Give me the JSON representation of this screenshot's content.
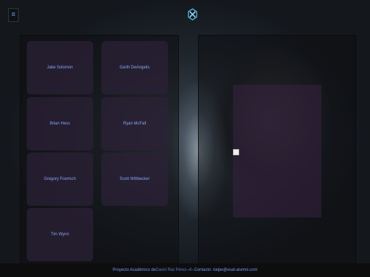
{
  "header": {
    "menu_icon": "hamburger-menu-icon",
    "logo_icon": "x-files-logo-icon"
  },
  "cast": [
    "Jake Solomon",
    "Garth DeAngelis",
    "Brian Hess",
    "Ryan McFall",
    "Gregory Foertsch",
    "Scott Wittbecker",
    "Tim Wynn"
  ],
  "footer": {
    "prefix": "Proyecto Académico de ",
    "author": "David Rial Pérez",
    "separator": " --//-- ",
    "contact": "Contacto: rialpe@esat-alumni.com"
  },
  "colors": {
    "accent": "#8aa6ff",
    "card": "#2c2138"
  }
}
